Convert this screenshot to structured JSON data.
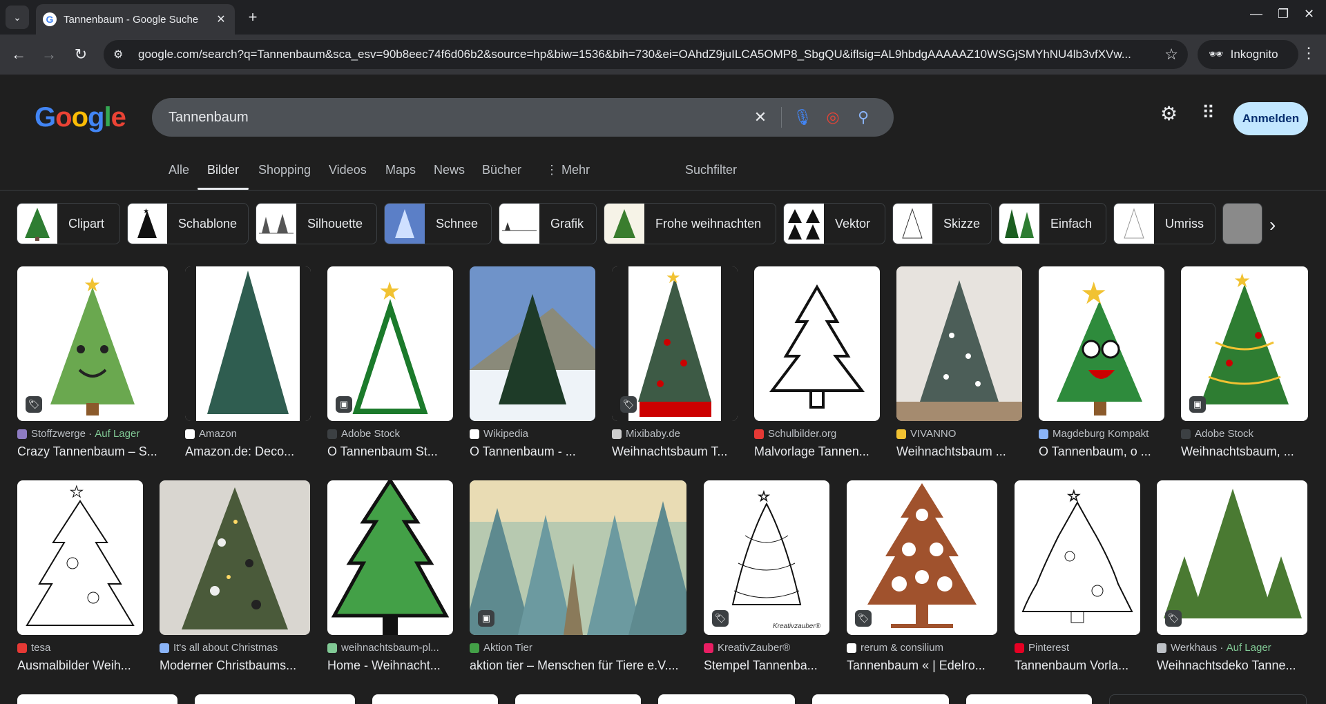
{
  "browser": {
    "tab_title": "Tannenbaum - Google Suche",
    "url": "google.com/search?q=Tannenbaum&sca_esv=90b8eec74f6d06b2&source=hp&biw=1536&bih=730&ei=OAhdZ9juILCA5OMP8_SbgQU&iflsig=AL9hbdgAAAAAZ10WSGjSMYhNU4lb3vfXVw...",
    "incognito_label": "Inkognito"
  },
  "search": {
    "query": "Tannenbaum",
    "signin_label": "Anmelden"
  },
  "nav": {
    "tabs": [
      "Alle",
      "Bilder",
      "Shopping",
      "Videos",
      "Maps",
      "News",
      "Bücher",
      "Mehr"
    ],
    "active": "Bilder",
    "filter_label": "Suchfilter"
  },
  "chips": [
    "Clipart",
    "Schablone",
    "Silhouette",
    "Schnee",
    "Grafik",
    "Frohe weihnachten",
    "Vektor",
    "Skizze",
    "Einfach",
    "Umriss"
  ],
  "results_row1": [
    {
      "source": "Stoffzwerge",
      "stock": "Auf Lager",
      "caption": "Crazy Tannenbaum – S..."
    },
    {
      "source": "Amazon",
      "caption": "Amazon.de: Deco..."
    },
    {
      "source": "Adobe Stock",
      "caption": "O Tannenbaum St..."
    },
    {
      "source": "Wikipedia",
      "caption": "O Tannenbaum - ..."
    },
    {
      "source": "Mixibaby.de",
      "caption": "Weihnachtsbaum T..."
    },
    {
      "source": "Schulbilder.org",
      "caption": "Malvorlage Tannen..."
    },
    {
      "source": "VIVANNO",
      "caption": "Weihnachtsbaum ..."
    },
    {
      "source": "Magdeburg Kompakt",
      "caption": "O Tannenbaum, o ..."
    },
    {
      "source": "Adobe Stock",
      "caption": "Weihnachtsbaum, ..."
    }
  ],
  "results_row2": [
    {
      "source": "tesa",
      "caption": "Ausmalbilder Weih..."
    },
    {
      "source": "It's all about Christmas",
      "caption": "Moderner Christbaums..."
    },
    {
      "source": "weihnachtsbaum-pl...",
      "caption": "Home - Weihnacht..."
    },
    {
      "source": "Aktion Tier",
      "caption": "aktion tier – Menschen für Tiere e.V...."
    },
    {
      "source": "KreativZauber®",
      "caption": "Stempel Tannenba..."
    },
    {
      "source": "rerum & consilium",
      "caption": "Tannenbaum « | Edelro..."
    },
    {
      "source": "Pinterest",
      "caption": "Tannenbaum Vorla..."
    },
    {
      "source": "Werkhaus",
      "stock": "Auf Lager",
      "caption": "Weihnachtsdeko Tanne..."
    }
  ]
}
